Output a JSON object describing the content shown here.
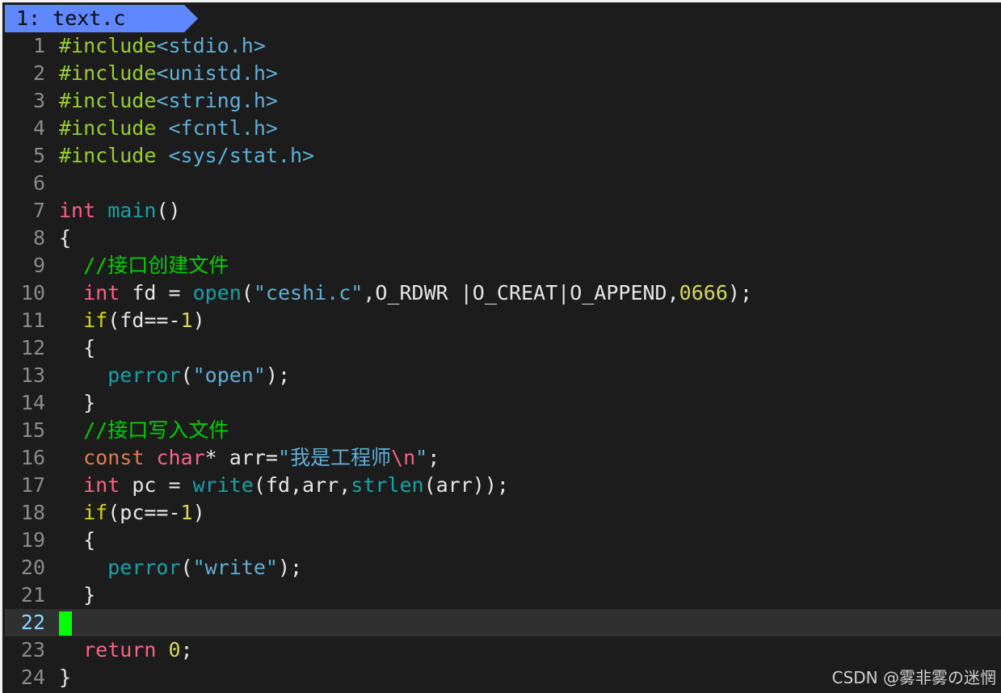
{
  "tab": {
    "label": "1: text.c"
  },
  "lines": [
    {
      "n": " 1",
      "parts": [
        [
          "c-pre",
          "#include"
        ],
        [
          "c-hdr",
          "<stdio.h>"
        ]
      ]
    },
    {
      "n": " 2",
      "parts": [
        [
          "c-pre",
          "#include"
        ],
        [
          "c-hdr",
          "<unistd.h>"
        ]
      ]
    },
    {
      "n": " 3",
      "parts": [
        [
          "c-pre",
          "#include"
        ],
        [
          "c-hdr",
          "<string.h>"
        ]
      ]
    },
    {
      "n": " 4",
      "parts": [
        [
          "c-pre",
          "#include "
        ],
        [
          "c-hdr",
          "<fcntl.h>"
        ]
      ]
    },
    {
      "n": " 5",
      "parts": [
        [
          "c-pre",
          "#include "
        ],
        [
          "c-hdr",
          "<sys/stat.h>"
        ]
      ]
    },
    {
      "n": " 6",
      "parts": []
    },
    {
      "n": " 7",
      "parts": [
        [
          "c-kw",
          "int"
        ],
        [
          "c-plain",
          " "
        ],
        [
          "c-fn",
          "main"
        ],
        [
          "c-plain",
          "()"
        ]
      ]
    },
    {
      "n": " 8",
      "parts": [
        [
          "c-plain",
          "{"
        ]
      ]
    },
    {
      "n": " 9",
      "parts": [
        [
          "c-plain",
          "  "
        ],
        [
          "c-com",
          "//接口创建文件"
        ]
      ]
    },
    {
      "n": "10",
      "parts": [
        [
          "c-plain",
          "  "
        ],
        [
          "c-kw",
          "int"
        ],
        [
          "c-plain",
          " fd = "
        ],
        [
          "c-fn",
          "open"
        ],
        [
          "c-plain",
          "("
        ],
        [
          "c-str",
          "\"ceshi.c\""
        ],
        [
          "c-plain",
          ",O_RDWR |O_CREAT|O_APPEND,"
        ],
        [
          "c-num",
          "0666"
        ],
        [
          "c-plain",
          ");"
        ]
      ]
    },
    {
      "n": "11",
      "parts": [
        [
          "c-plain",
          "  "
        ],
        [
          "c-if",
          "if"
        ],
        [
          "c-plain",
          "(fd==-"
        ],
        [
          "c-num",
          "1"
        ],
        [
          "c-plain",
          ")"
        ]
      ]
    },
    {
      "n": "12",
      "parts": [
        [
          "c-plain",
          "  {"
        ]
      ]
    },
    {
      "n": "13",
      "parts": [
        [
          "c-plain",
          "    "
        ],
        [
          "c-fn",
          "perror"
        ],
        [
          "c-plain",
          "("
        ],
        [
          "c-str",
          "\"open\""
        ],
        [
          "c-plain",
          ");"
        ]
      ]
    },
    {
      "n": "14",
      "parts": [
        [
          "c-plain",
          "  }"
        ]
      ]
    },
    {
      "n": "15",
      "parts": [
        [
          "c-plain",
          "  "
        ],
        [
          "c-com",
          "//接口写入文件"
        ]
      ]
    },
    {
      "n": "16",
      "parts": [
        [
          "c-plain",
          "  "
        ],
        [
          "c-const",
          "const"
        ],
        [
          "c-plain",
          " "
        ],
        [
          "c-kw",
          "char"
        ],
        [
          "c-plain",
          "* arr="
        ],
        [
          "c-str",
          "\"我是工程师"
        ],
        [
          "c-esc",
          "\\n"
        ],
        [
          "c-str",
          "\""
        ],
        [
          "c-plain",
          ";"
        ]
      ]
    },
    {
      "n": "17",
      "parts": [
        [
          "c-plain",
          "  "
        ],
        [
          "c-kw",
          "int"
        ],
        [
          "c-plain",
          " pc = "
        ],
        [
          "c-fn",
          "write"
        ],
        [
          "c-plain",
          "(fd,arr,"
        ],
        [
          "c-fn",
          "strlen"
        ],
        [
          "c-plain",
          "(arr));"
        ]
      ]
    },
    {
      "n": "18",
      "parts": [
        [
          "c-plain",
          "  "
        ],
        [
          "c-if",
          "if"
        ],
        [
          "c-plain",
          "(pc==-"
        ],
        [
          "c-num",
          "1"
        ],
        [
          "c-plain",
          ")"
        ]
      ]
    },
    {
      "n": "19",
      "parts": [
        [
          "c-plain",
          "  {"
        ]
      ]
    },
    {
      "n": "20",
      "parts": [
        [
          "c-plain",
          "    "
        ],
        [
          "c-fn",
          "perror"
        ],
        [
          "c-plain",
          "("
        ],
        [
          "c-str",
          "\"write\""
        ],
        [
          "c-plain",
          ");"
        ]
      ]
    },
    {
      "n": "21",
      "parts": [
        [
          "c-plain",
          "  }"
        ]
      ]
    },
    {
      "n": "22",
      "parts": [],
      "current": true
    },
    {
      "n": "23",
      "parts": [
        [
          "c-plain",
          "  "
        ],
        [
          "c-kw",
          "return"
        ],
        [
          "c-plain",
          " "
        ],
        [
          "c-num",
          "0"
        ],
        [
          "c-plain",
          ";"
        ]
      ]
    },
    {
      "n": "24",
      "parts": [
        [
          "c-plain",
          "}"
        ]
      ]
    }
  ],
  "watermark": "CSDN @雾非雾の迷惘",
  "colors": {
    "tab_bg": "#5f87ff",
    "cursor": "#00ff00",
    "background": "#1c1c1c"
  }
}
